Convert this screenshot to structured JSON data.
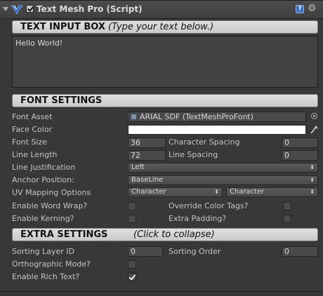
{
  "component": {
    "title": "Text Mesh Pro (Script)",
    "enabled": true,
    "icons": [
      "foldout-arrow-icon",
      "tmp-logo-icon",
      "help-icon",
      "gear-icon"
    ]
  },
  "text_input": {
    "header": "TEXT INPUT BOX",
    "subheader": "(Type your text below.)",
    "value": "Hello World!"
  },
  "font_settings": {
    "header": "FONT SETTINGS",
    "font_asset_label": "Font Asset",
    "font_asset_value": "ARIAL SDF (TextMeshProFont)",
    "face_color_label": "Face Color",
    "face_color": "#ffffff",
    "font_size_label": "Font Size",
    "font_size_value": "36",
    "char_spacing_label": "Character Spacing",
    "char_spacing_value": "0",
    "line_length_label": "Line Length",
    "line_length_value": "72",
    "line_spacing_label": "Line Spacing",
    "line_spacing_value": "0",
    "line_justification_label": "Line Justification",
    "line_justification_value": "Left",
    "anchor_position_label": "Anchor Position:",
    "anchor_position_value": "BaseLine",
    "uv_mapping_label": "UV Mapping Options",
    "uv_mapping_value_1": "Character",
    "uv_mapping_value_2": "Character",
    "word_wrap_label": "Enable Word Wrap?",
    "word_wrap": false,
    "override_tags_label": "Override Color Tags?",
    "override_tags": false,
    "kerning_label": "Enable Kerning?",
    "kerning": false,
    "extra_padding_label": "Extra Padding?",
    "extra_padding": false
  },
  "extra_settings": {
    "header": "EXTRA SETTINGS",
    "subheader": "(Click to collapse)",
    "sorting_layer_label": "Sorting Layer ID",
    "sorting_layer_value": "0",
    "sorting_order_label": "Sorting Order",
    "sorting_order_value": "0",
    "ortho_label": "Orthographic Mode?",
    "ortho": false,
    "rich_text_label": "Enable Rich Text?",
    "rich_text": true
  },
  "colors": {
    "panel_bg": "#383838",
    "header_bg": "#d6d6d6",
    "help_icon": "#3a6fc9"
  }
}
